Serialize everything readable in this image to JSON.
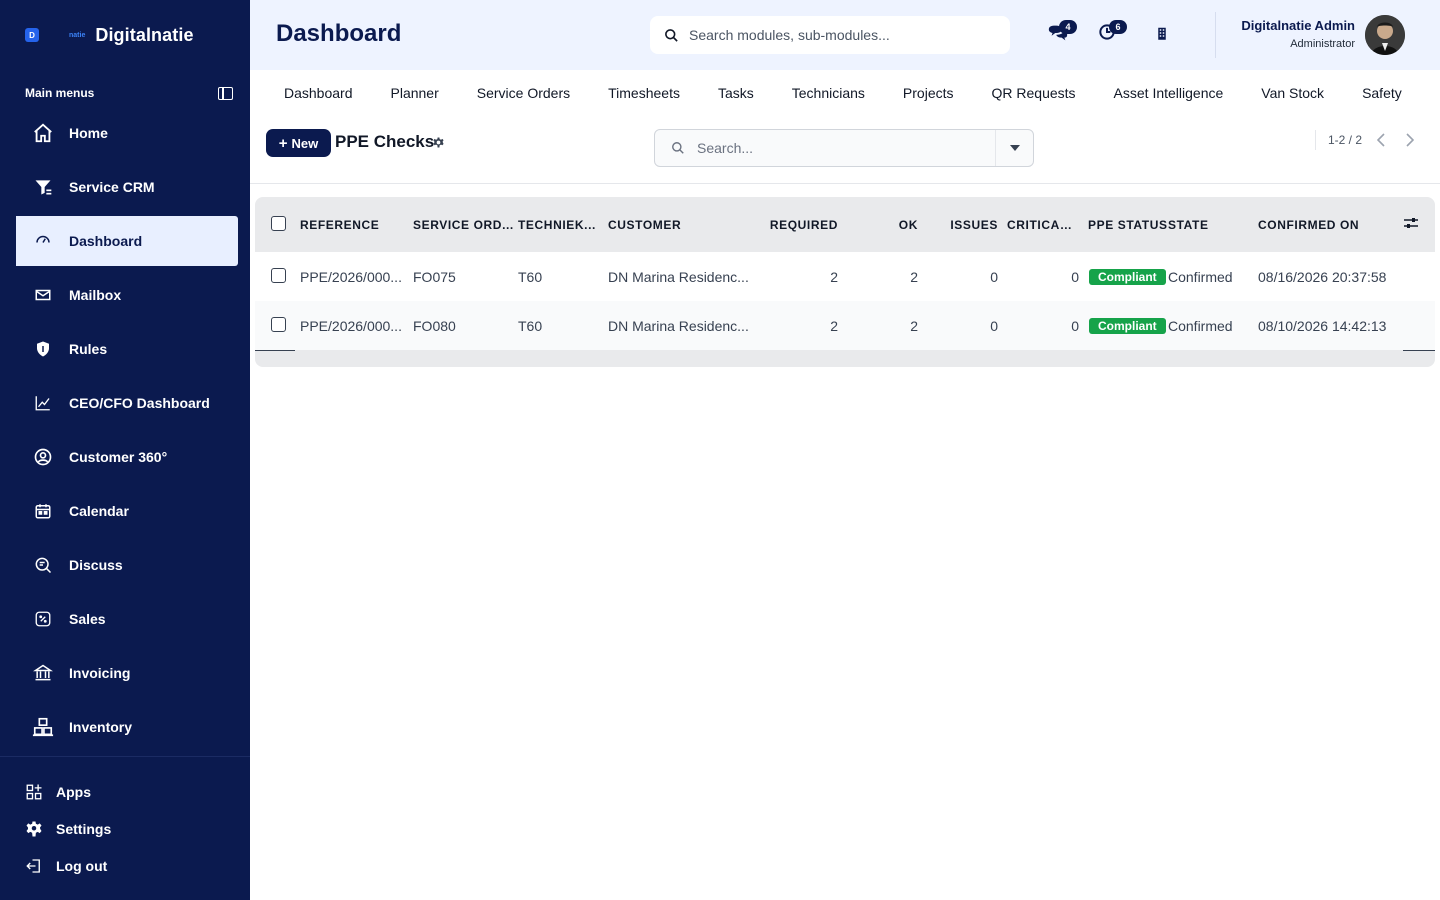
{
  "brand": {
    "badge": "D",
    "small": "natie",
    "name": "Digitalnatie"
  },
  "sidebar": {
    "heading": "Main menus",
    "items": [
      {
        "label": "Home",
        "icon": "home-icon"
      },
      {
        "label": "Service CRM",
        "icon": "funnel-icon"
      },
      {
        "label": "Dashboard",
        "icon": "dashboard-icon",
        "active": true
      },
      {
        "label": "Mailbox",
        "icon": "mail-icon"
      },
      {
        "label": "Rules",
        "icon": "shield-icon"
      },
      {
        "label": "CEO/CFO Dashboard",
        "icon": "chart-line-icon"
      },
      {
        "label": "Customer 360°",
        "icon": "user-circle-icon"
      },
      {
        "label": "Calendar",
        "icon": "calendar-icon"
      },
      {
        "label": "Discuss",
        "icon": "discuss-icon"
      },
      {
        "label": "Sales",
        "icon": "percent-icon"
      },
      {
        "label": "Invoicing",
        "icon": "bank-icon"
      },
      {
        "label": "Inventory",
        "icon": "warehouse-icon"
      }
    ],
    "bottom": {
      "apps": "Apps",
      "settings": "Settings",
      "logout": "Log out"
    }
  },
  "header": {
    "title": "Dashboard",
    "search_placeholder": "Search modules, sub-modules...",
    "messages_count": "4",
    "activities_count": "6",
    "user_name": "Digitalnatie Admin",
    "user_role": "Administrator"
  },
  "tabs": [
    "Dashboard",
    "Planner",
    "Service Orders",
    "Timesheets",
    "Tasks",
    "Technicians",
    "Projects",
    "QR Requests",
    "Asset Intelligence",
    "Van Stock",
    "Safety"
  ],
  "control": {
    "new_label": "New",
    "list_title": "PPE Checks",
    "search_placeholder": "Search...",
    "pager": "1-2 / 2"
  },
  "table": {
    "columns": [
      "REFERENCE",
      "SERVICE ORD...",
      "TECHNIEK...",
      "CUSTOMER",
      "REQUIRED",
      "OK",
      "ISSUES",
      "CRITICAL ...",
      "PPE STATUS",
      "STATE",
      "CONFIRMED ON"
    ],
    "rows": [
      [
        "PPE/2026/000...",
        "FO075",
        "T60",
        "DN Marina Residenc...",
        "2",
        "2",
        "0",
        "0",
        "Compliant",
        "Confirmed",
        "08/16/2026 20:37:58"
      ],
      [
        "PPE/2026/000...",
        "FO080",
        "T60",
        "DN Marina Residenc...",
        "2",
        "2",
        "0",
        "0",
        "Compliant",
        "Confirmed",
        "08/10/2026 14:42:13"
      ]
    ]
  },
  "colors": {
    "sidebar_bg": "#0b1a4f",
    "header_bg": "#eef3ff",
    "active_item_bg": "#e8efff",
    "status_compliant": "#16a34a"
  }
}
